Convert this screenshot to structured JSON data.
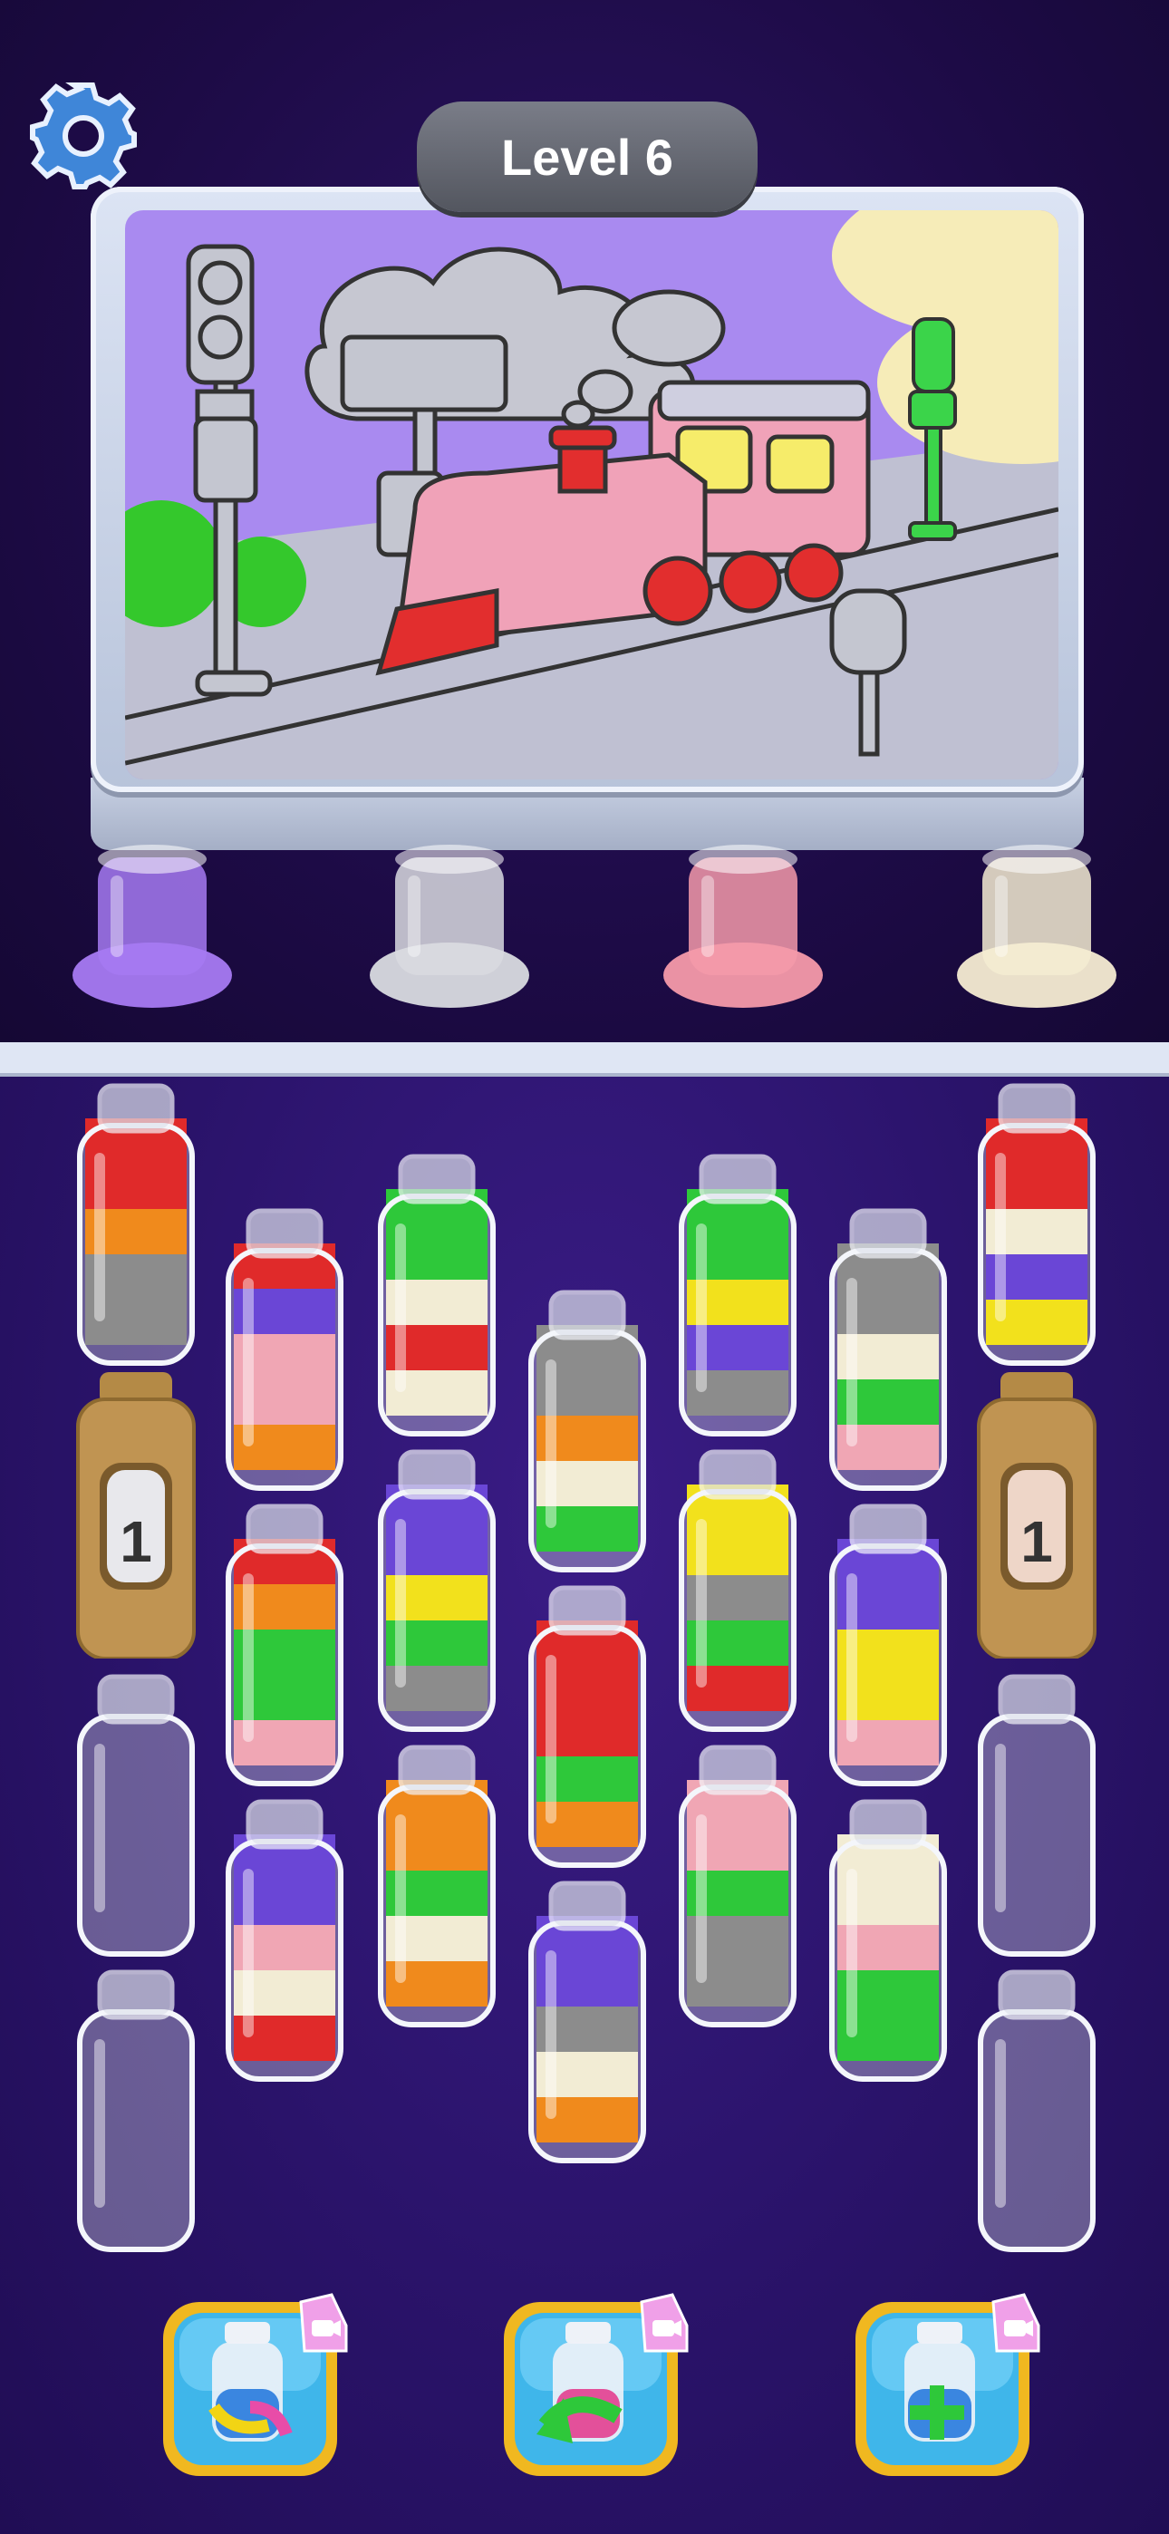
{
  "level": {
    "label": "Level 6"
  },
  "palette": {
    "red": "#e02a2a",
    "orange": "#f08a1c",
    "gray": "#8c8c8c",
    "purple": "#6a46d6",
    "pink": "#f0a6b4",
    "green": "#2ec83a",
    "white": "#f2ecd4",
    "yellow": "#f2e11c",
    "empty": "#d6dbe6"
  },
  "targets": [
    {
      "color": "#a67af2",
      "name": "purple-jar"
    },
    {
      "color": "#d9dbe0",
      "name": "gray-jar"
    },
    {
      "color": "#f59aaa",
      "name": "pink-jar"
    },
    {
      "color": "#f5ecd2",
      "name": "cream-jar"
    }
  ],
  "tubes": [
    [
      "red",
      "red",
      "orange",
      "gray",
      "gray"
    ],
    [
      "red",
      "purple",
      "pink",
      "pink",
      "orange"
    ],
    [
      "green",
      "green",
      "white",
      "red",
      "white"
    ],
    [
      "gray",
      "gray",
      "orange",
      "white",
      "green"
    ],
    [
      "green",
      "green",
      "yellow",
      "purple",
      "gray"
    ],
    [
      "gray",
      "gray",
      "white",
      "green",
      "pink"
    ],
    [
      "red",
      "red",
      "white",
      "purple",
      "yellow"
    ],
    [
      "red",
      "orange",
      "green",
      "green",
      "pink"
    ],
    [
      "purple",
      "purple",
      "yellow",
      "green",
      "gray"
    ],
    [
      "red",
      "red",
      "red",
      "green",
      "orange"
    ],
    [
      "yellow",
      "yellow",
      "gray",
      "green",
      "red"
    ],
    [
      "purple",
      "purple",
      "yellow",
      "yellow",
      "pink"
    ],
    [
      "purple",
      "purple",
      "pink",
      "white",
      "red"
    ],
    [
      "orange",
      "orange",
      "green",
      "white",
      "orange"
    ],
    [
      "purple",
      "purple",
      "gray",
      "white",
      "orange"
    ],
    [
      "pink",
      "pink",
      "green",
      "gray",
      "gray"
    ],
    [
      "white",
      "white",
      "pink",
      "green",
      "green"
    ]
  ],
  "locked_bottles": [
    {
      "count": "1"
    },
    {
      "count": "1"
    }
  ],
  "boosters": [
    {
      "name": "shuffle-booster-button"
    },
    {
      "name": "undo-booster-button"
    },
    {
      "name": "add-tube-booster-button"
    }
  ]
}
